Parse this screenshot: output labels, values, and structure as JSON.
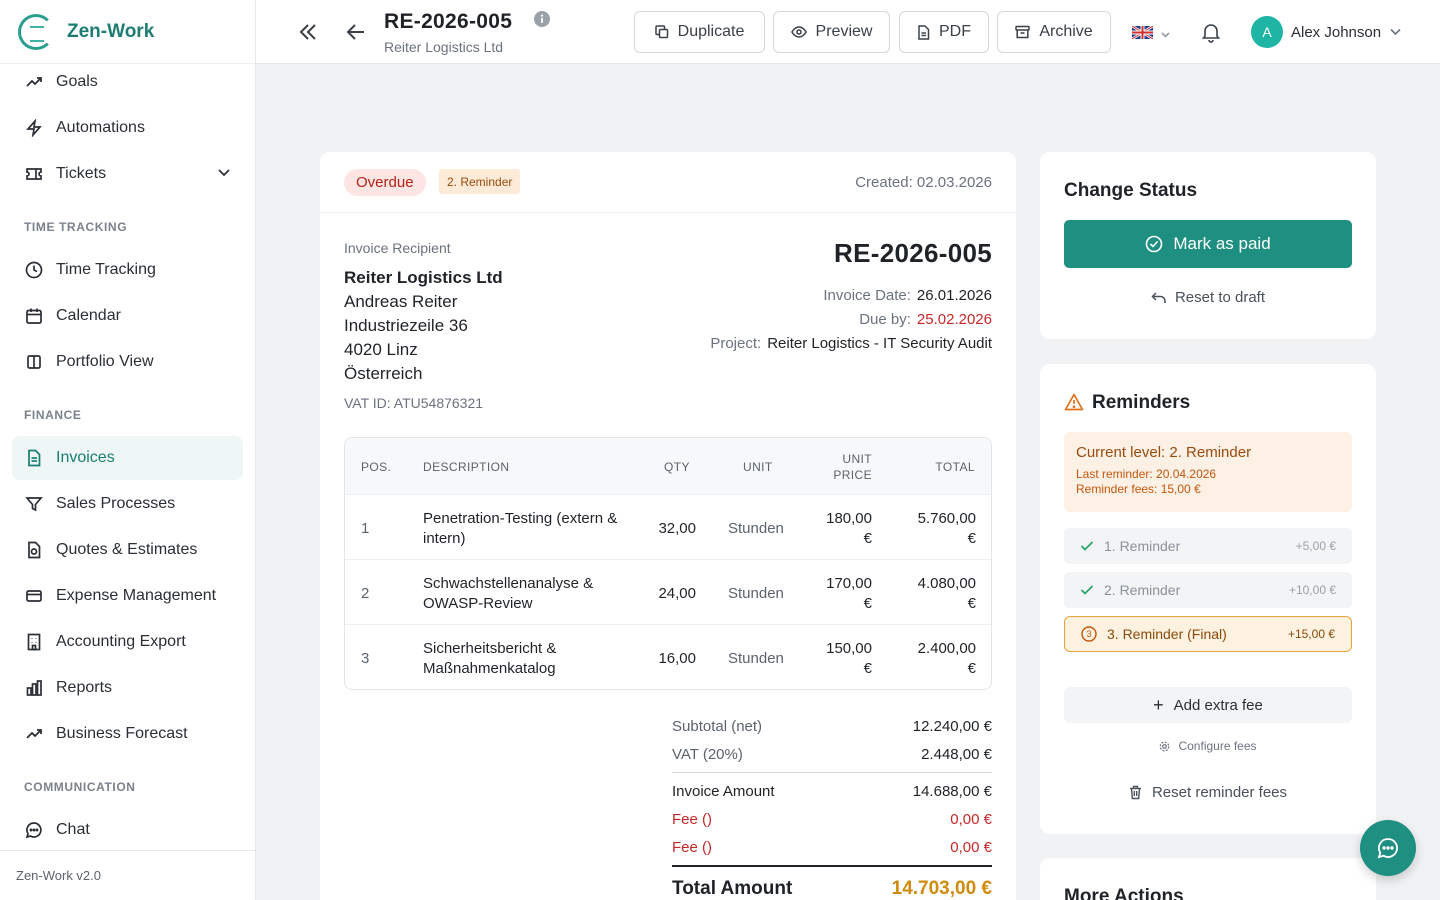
{
  "app": {
    "name": "Zen-Work",
    "version": "Zen-Work v2.0"
  },
  "sidebar": {
    "items_top": [
      {
        "label": "Goals",
        "icon": "trend-icon"
      },
      {
        "label": "Automations",
        "icon": "bolt-icon"
      },
      {
        "label": "Tickets",
        "icon": "ticket-icon"
      }
    ],
    "section_time": "TIME TRACKING",
    "items_time": [
      {
        "label": "Time Tracking",
        "icon": "clock-icon"
      },
      {
        "label": "Calendar",
        "icon": "calendar-icon"
      },
      {
        "label": "Portfolio View",
        "icon": "columns-icon"
      }
    ],
    "section_finance": "FINANCE",
    "items_finance": [
      {
        "label": "Invoices",
        "icon": "document-icon",
        "active": true
      },
      {
        "label": "Sales Processes",
        "icon": "funnel-icon"
      },
      {
        "label": "Quotes & Estimates",
        "icon": "quote-icon"
      },
      {
        "label": "Expense Management",
        "icon": "card-icon"
      },
      {
        "label": "Accounting Export",
        "icon": "building-icon"
      },
      {
        "label": "Reports",
        "icon": "bar-chart-icon"
      },
      {
        "label": "Business Forecast",
        "icon": "trend-icon"
      }
    ],
    "section_comm": "COMMUNICATION",
    "items_comm": [
      {
        "label": "Chat",
        "icon": "chat-icon"
      }
    ]
  },
  "header": {
    "title": "RE-2026-005",
    "subtitle": "Reiter Logistics Ltd",
    "duplicate": "Duplicate",
    "preview": "Preview",
    "pdf": "PDF",
    "archive": "Archive",
    "user_initial": "A",
    "user_name": "Alex Johnson"
  },
  "invoice": {
    "status": "Overdue",
    "reminder_badge": "2. Reminder",
    "created": "Created: 02.03.2026",
    "recipient_label": "Invoice Recipient",
    "recipient": {
      "company": "Reiter Logistics Ltd",
      "person": "Andreas Reiter",
      "street": "Industriezeile 36",
      "city": "4020 Linz",
      "country": "Österreich"
    },
    "vat_id": "VAT ID: ATU54876321",
    "number": "RE-2026-005",
    "invoice_date_label": "Invoice Date:",
    "invoice_date": "26.01.2026",
    "due_label": "Due by:",
    "due_date": "25.02.2026",
    "project_label": "Project:",
    "project": "Reiter Logistics - IT Security Audit",
    "columns": {
      "pos": "POS.",
      "desc": "DESCRIPTION",
      "qty": "QTY",
      "unit": "UNIT",
      "price_1": "UNIT",
      "price_2": "PRICE",
      "total": "TOTAL"
    },
    "rows": [
      {
        "pos": "1",
        "desc": "Penetration-Testing (extern & intern)",
        "qty": "32,00",
        "unit": "Stunden",
        "price": "180,00",
        "price_cur": "€",
        "total": "5.760,00",
        "total_cur": "€"
      },
      {
        "pos": "2",
        "desc": "Schwachstellenanalyse & OWASP-Review",
        "qty": "24,00",
        "unit": "Stunden",
        "price": "170,00",
        "price_cur": "€",
        "total": "4.080,00",
        "total_cur": "€"
      },
      {
        "pos": "3",
        "desc": "Sicherheitsbericht & Maßnahmenkatalog",
        "qty": "16,00",
        "unit": "Stunden",
        "price": "150,00",
        "price_cur": "€",
        "total": "2.400,00",
        "total_cur": "€"
      }
    ],
    "totals": {
      "subtotal_label": "Subtotal (net)",
      "subtotal": "12.240,00 €",
      "vat_label": "VAT (20%)",
      "vat": "2.448,00 €",
      "amount_label": "Invoice Amount",
      "amount": "14.688,00 €",
      "fee1_label": "Fee ()",
      "fee1": "0,00 €",
      "fee2_label": "Fee ()",
      "fee2": "0,00 €",
      "grand_label": "Total Amount",
      "grand": "14.703,00 €"
    }
  },
  "status_card": {
    "title": "Change Status",
    "mark_paid": "Mark as paid",
    "reset_draft": "Reset to draft"
  },
  "reminders": {
    "title": "Reminders",
    "current_level": "Current level: 2. Reminder",
    "last_reminder": "Last reminder: 20.04.2026",
    "fees": "Reminder fees: 15,00 €",
    "steps": [
      {
        "label": "1. Reminder",
        "fee": "+5,00 €",
        "state": "done"
      },
      {
        "label": "2. Reminder",
        "fee": "+10,00 €",
        "state": "done"
      },
      {
        "label": "3. Reminder (Final)",
        "fee": "+15,00 €",
        "state": "next"
      }
    ],
    "add_fee": "Add extra fee",
    "configure": "Configure fees",
    "reset_fees": "Reset reminder fees"
  },
  "more": {
    "title": "More Actions"
  },
  "colors": {
    "accent": "#1f8f82",
    "danger": "#c62828",
    "warning": "#d18b0a"
  }
}
